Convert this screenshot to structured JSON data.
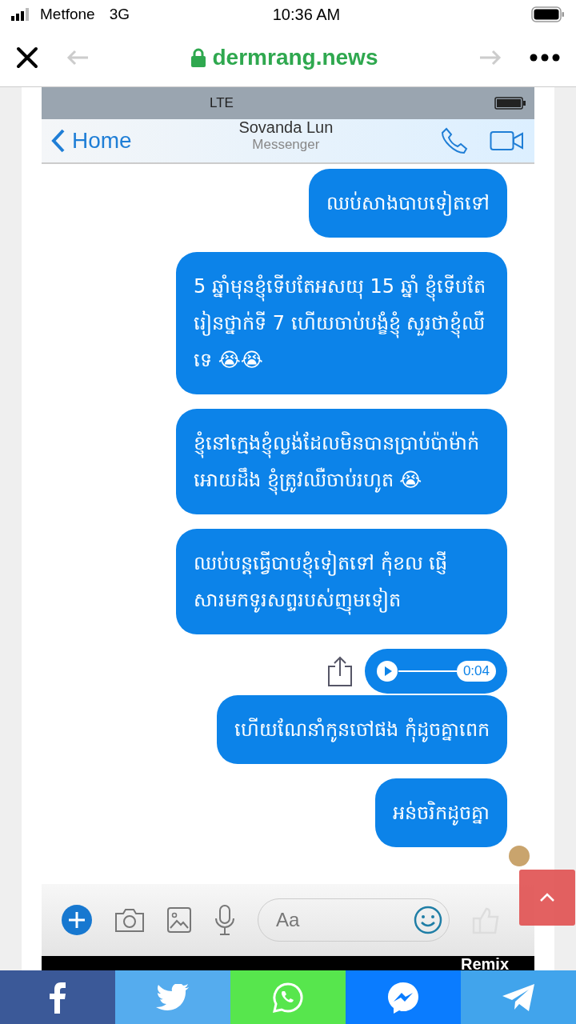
{
  "status_bar": {
    "carrier": "Metfone",
    "network": "3G",
    "time": "10:36 AM"
  },
  "browser": {
    "domain": "dermrang.news"
  },
  "chat": {
    "inner_status": {
      "network": "LTE"
    },
    "contact": "Sovanda Lun",
    "subtitle": "Messenger",
    "back_label": "Home",
    "messages": [
      {
        "kind": "text",
        "text": "ឈប់សាងបាបទៀតទៅ"
      },
      {
        "kind": "text",
        "text": "5 ឆ្នាំមុនខ្ញុំទើបតែអសយុ 15 ឆ្នាំ ខ្ញុំទើបតែរៀនថ្នាក់ទី 7 ហើយចាប់បង្ខំខ្ញុំ សួរថាខ្ញុំឈឺទេ 😭😭"
      },
      {
        "kind": "text",
        "text": "ខ្ញុំនៅក្មេងខ្ញុំល្ងង់ដែលមិនបានប្រាប់ប៉ាម៉ាក់ អោយដឹង ខ្ញុំត្រូវឈឺចាប់រហូត 😭"
      },
      {
        "kind": "text",
        "text": "ឈប់បន្តធ្វើបាបខ្ញុំទៀតទៅ កុំខល ផ្ញើសារមកទូរសព្ទរបស់ញុមទៀត"
      },
      {
        "kind": "audio",
        "duration": "0:04"
      },
      {
        "kind": "text",
        "text": "ហើយណែនាំកូនចៅផង កុំដូចគ្នាពេក"
      },
      {
        "kind": "text",
        "text": "អន់ចរិកដូចគ្នា"
      }
    ],
    "composer": {
      "placeholder": "Aa"
    },
    "footer_label": "Remix"
  }
}
